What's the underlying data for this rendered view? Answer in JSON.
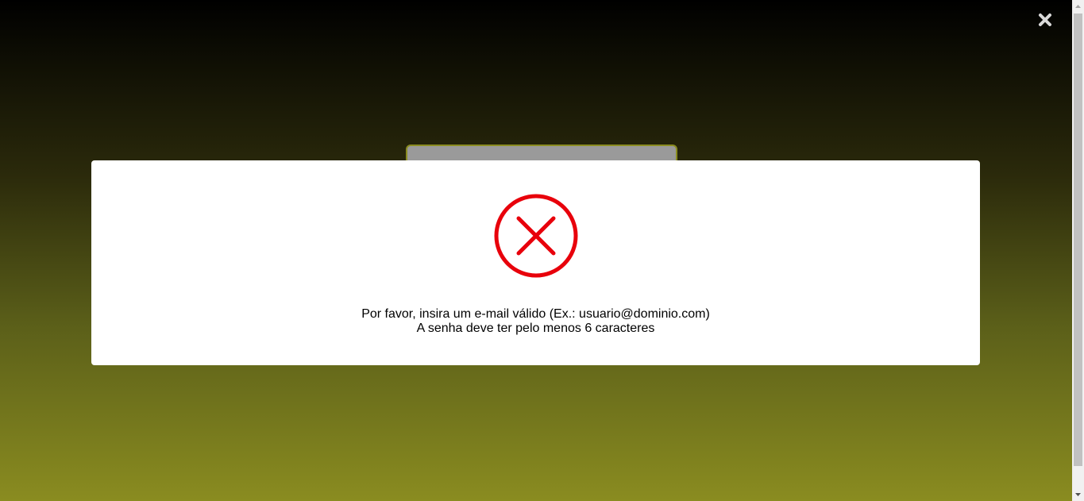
{
  "overlay": {
    "close_icon": "close-icon"
  },
  "modal": {
    "icon": "error-circle-x-icon",
    "icon_color": "#e8000b",
    "messages": [
      "Por favor, insira um e-mail válido (Ex.: usuario@dominio.com)",
      "A senha deve ter pelo menos 6 caracteres"
    ]
  },
  "colors": {
    "background_top": "#000000",
    "background_bottom": "#8a8c20",
    "modal_background": "#ffffff"
  }
}
